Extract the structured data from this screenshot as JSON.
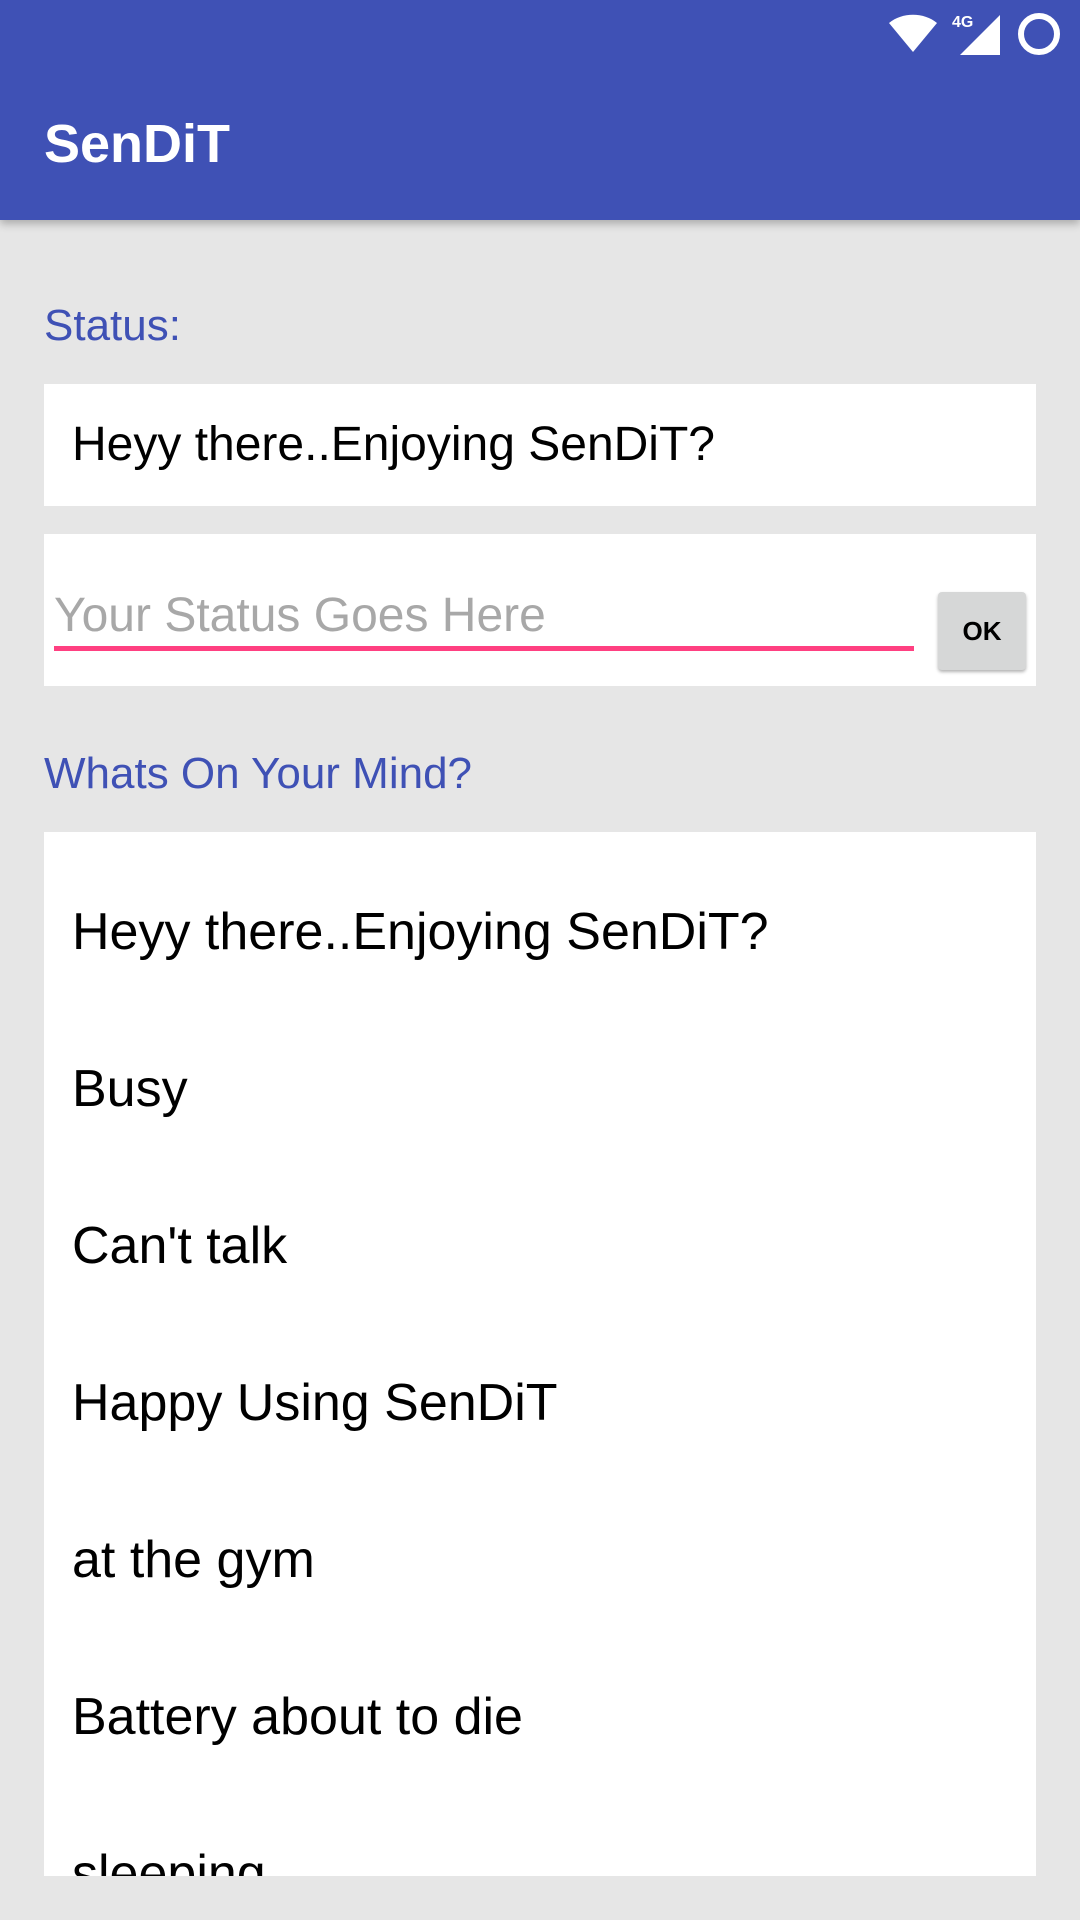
{
  "status_bar": {
    "icons": [
      "wifi-icon",
      "cellular-4g-icon",
      "battery-icon"
    ],
    "network_label": "4G"
  },
  "app_bar": {
    "title": "SenDiT",
    "color": "#3f51b5"
  },
  "status_section": {
    "label": "Status:",
    "current_status": "Heyy there..Enjoying SenDiT?",
    "input_value": "",
    "input_placeholder": "Your Status Goes Here",
    "ok_label": "OK",
    "accent_color": "#ff4081"
  },
  "mind_section": {
    "label": "Whats On Your Mind?",
    "items": [
      "Heyy there..Enjoying SenDiT?",
      "Busy",
      "Can't talk",
      "Happy Using SenDiT",
      "at the gym",
      "Battery about to die",
      "sleeping"
    ]
  }
}
